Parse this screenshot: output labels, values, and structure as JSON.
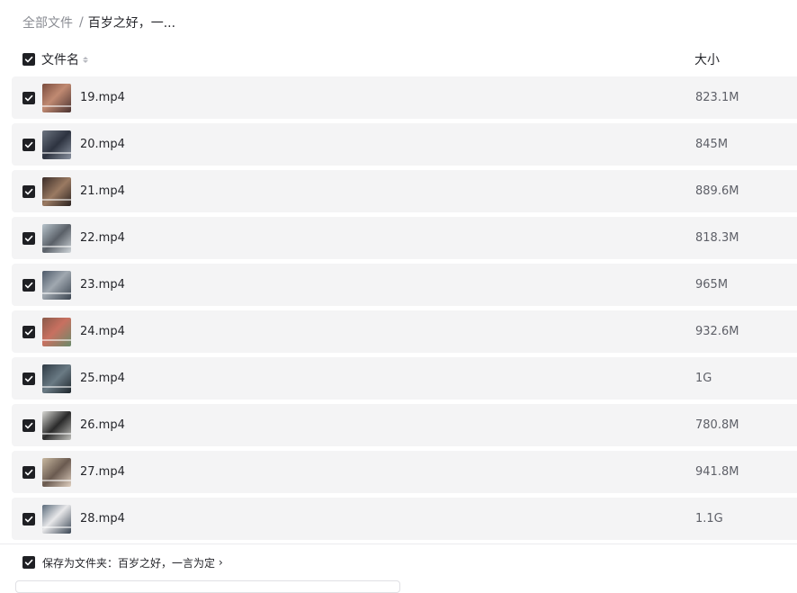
{
  "breadcrumb": {
    "root": "全部文件",
    "separator": "/",
    "current": "百岁之好，一..."
  },
  "table_header": {
    "name_label": "文件名",
    "size_label": "大小"
  },
  "files": [
    {
      "name": "19.mp4",
      "size": "823.1M",
      "checked": true
    },
    {
      "name": "20.mp4",
      "size": "845M",
      "checked": true
    },
    {
      "name": "21.mp4",
      "size": "889.6M",
      "checked": true
    },
    {
      "name": "22.mp4",
      "size": "818.3M",
      "checked": true
    },
    {
      "name": "23.mp4",
      "size": "965M",
      "checked": true
    },
    {
      "name": "24.mp4",
      "size": "932.6M",
      "checked": true
    },
    {
      "name": "25.mp4",
      "size": "1G",
      "checked": true
    },
    {
      "name": "26.mp4",
      "size": "780.8M",
      "checked": true
    },
    {
      "name": "27.mp4",
      "size": "941.8M",
      "checked": true
    },
    {
      "name": "28.mp4",
      "size": "1.1G",
      "checked": true
    }
  ],
  "save_to": {
    "label": "保存为文件夹：百岁之好，一言为定",
    "chevron": "›",
    "checked": true
  },
  "colors": {
    "checkbox": "#1f2024",
    "row_bg": "#f4f4f5",
    "muted_text": "#8a8c93"
  }
}
